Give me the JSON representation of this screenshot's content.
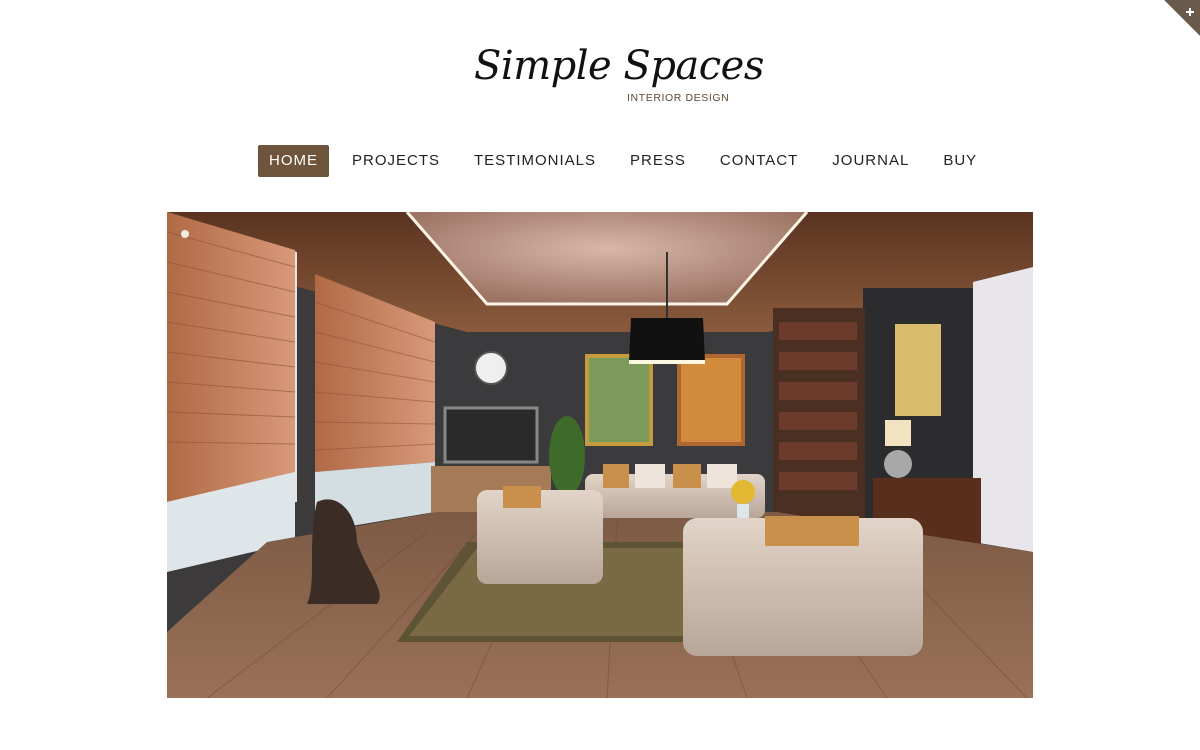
{
  "brand": {
    "name": "Simple Spaces",
    "tagline": "INTERIOR DESIGN"
  },
  "nav": {
    "items": [
      {
        "label": "HOME",
        "active": true
      },
      {
        "label": "PROJECTS",
        "active": false
      },
      {
        "label": "TESTIMONIALS",
        "active": false
      },
      {
        "label": "PRESS",
        "active": false
      },
      {
        "label": "CONTACT",
        "active": false
      },
      {
        "label": "JOURNAL",
        "active": false
      },
      {
        "label": "BUY",
        "active": false
      }
    ]
  },
  "hero": {
    "icon": "living-room-photo",
    "slider_position": 1
  },
  "corner": {
    "icon": "plus-icon"
  },
  "colors": {
    "accent": "#6e543a",
    "tagline": "#5b4732",
    "text": "#222222",
    "background": "#ffffff"
  }
}
